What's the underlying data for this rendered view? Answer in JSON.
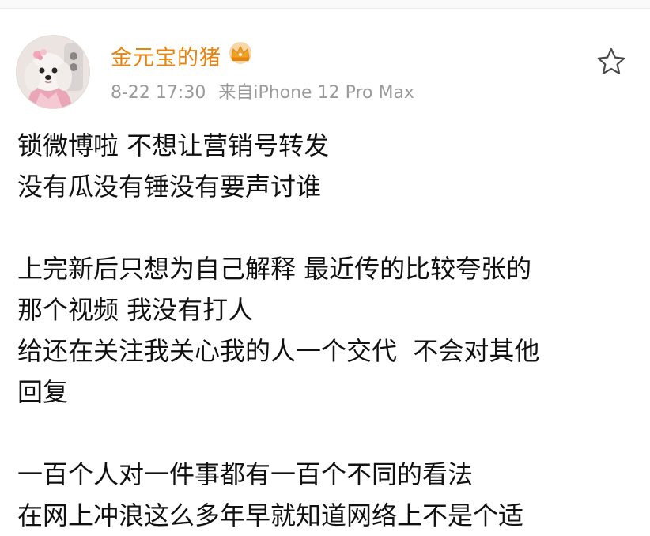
{
  "post": {
    "username": "金元宝的猪",
    "time": "8-22 17:30",
    "source": "来自iPhone 12 Pro Max",
    "icons": {
      "avatar": "dog-avatar",
      "badge": "crown-icon",
      "favorite": "star-icon"
    },
    "colors": {
      "username": "#e8830c",
      "meta": "#9a9a9a",
      "body": "#111111"
    },
    "paragraphs": [
      [
        "锁微博啦 不想让营销号转发",
        "没有瓜没有锤没有要声讨谁"
      ],
      [
        "上完新后只想为自己解释 最近传的比较夸张的",
        "那个视频 我没有打人",
        "给还在关注我关心我的人一个交代  不会对其他",
        "回复"
      ],
      [
        "一百个人对一件事都有一百个不同的看法",
        "在网上冲浪这么多年早就知道网络上不是个适"
      ]
    ]
  }
}
